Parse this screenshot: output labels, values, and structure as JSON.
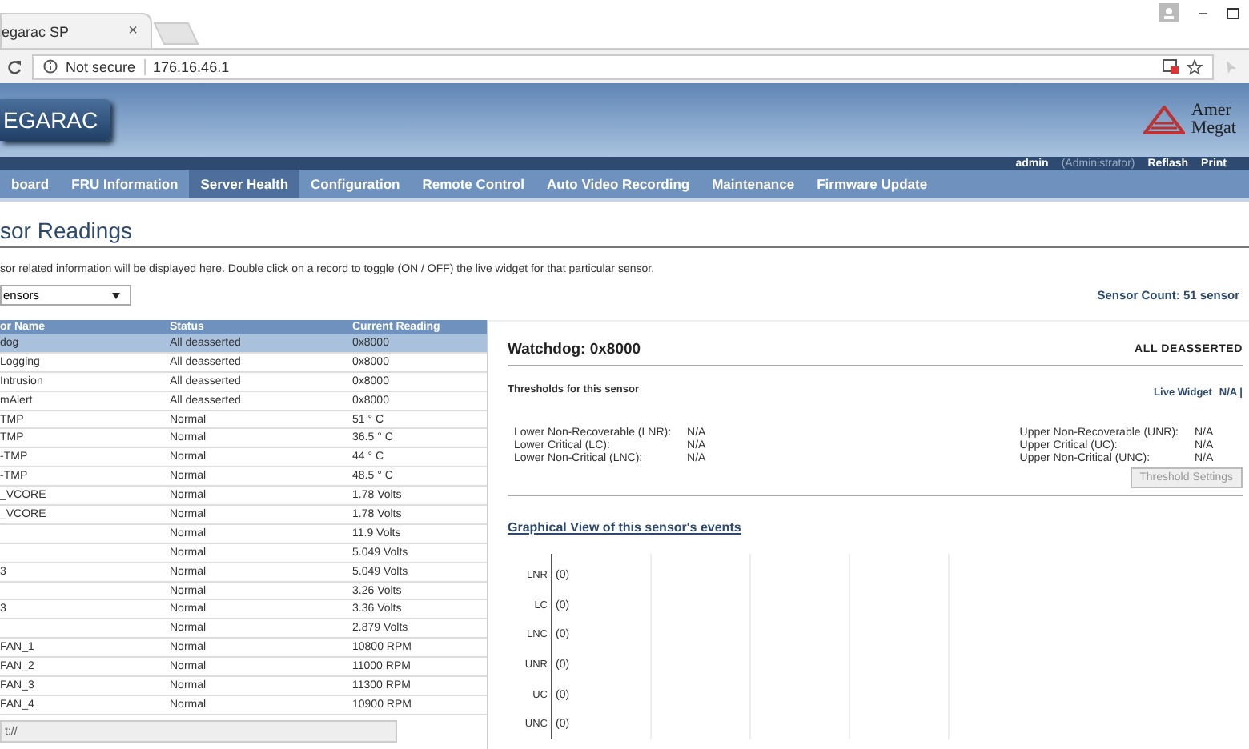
{
  "browser": {
    "tab_title": "egarac SP",
    "close": "×",
    "security": "Not secure",
    "url": "176.16.46.1",
    "window_controls": [
      "–"
    ]
  },
  "header": {
    "logo": "EGARAC",
    "brand_lines": [
      "Amer",
      "Megat"
    ],
    "user": "admin",
    "role": "(Administrator)",
    "links": [
      "Reflash",
      "Print"
    ]
  },
  "nav": [
    {
      "label": "board",
      "selected": false
    },
    {
      "label": "FRU Information",
      "selected": false
    },
    {
      "label": "Server Health",
      "selected": true
    },
    {
      "label": "Configuration",
      "selected": false
    },
    {
      "label": "Remote Control",
      "selected": false
    },
    {
      "label": "Auto Video Recording",
      "selected": false
    },
    {
      "label": "Maintenance",
      "selected": false
    },
    {
      "label": "Firmware Update",
      "selected": false
    }
  ],
  "page": {
    "title": "sor Readings",
    "description": "sor related information will be displayed here. Double click on a record to toggle (ON / OFF) the live widget for that particular sensor.",
    "filter": "ensors",
    "sensor_count": "Sensor Count: 51 sensor"
  },
  "table": {
    "columns": [
      "or Name",
      "Status",
      "Current Reading"
    ],
    "rows": [
      {
        "name": "dog",
        "status": "All deasserted",
        "reading": "0x8000",
        "selected": true
      },
      {
        "name": "Logging",
        "status": "All deasserted",
        "reading": "0x8000",
        "selected": false
      },
      {
        "name": "Intrusion",
        "status": "All deasserted",
        "reading": "0x8000",
        "selected": false
      },
      {
        "name": "mAlert",
        "status": "All deasserted",
        "reading": "0x8000",
        "selected": false
      },
      {
        "name": "TMP",
        "status": "Normal",
        "reading": "51 ° C",
        "selected": false
      },
      {
        "name": "TMP",
        "status": "Normal",
        "reading": "36.5 ° C",
        "selected": false
      },
      {
        "name": "-TMP",
        "status": "Normal",
        "reading": "44 ° C",
        "selected": false
      },
      {
        "name": "-TMP",
        "status": "Normal",
        "reading": "48.5 ° C",
        "selected": false
      },
      {
        "name": "_VCORE",
        "status": "Normal",
        "reading": "1.78 Volts",
        "selected": false
      },
      {
        "name": "_VCORE",
        "status": "Normal",
        "reading": "1.78 Volts",
        "selected": false
      },
      {
        "status": "Normal",
        "reading": "11.9 Volts",
        "selected": false
      },
      {
        "status": "Normal",
        "reading": "5.049 Volts",
        "selected": false
      },
      {
        "name": "3",
        "status": "Normal",
        "reading": "5.049 Volts",
        "selected": false
      },
      {
        "status": "Normal",
        "reading": "3.26 Volts",
        "selected": false
      },
      {
        "name": "3",
        "status": "Normal",
        "reading": "3.36 Volts",
        "selected": false
      },
      {
        "status": "Normal",
        "reading": "2.879 Volts",
        "selected": false
      },
      {
        "name": "FAN_1",
        "status": "Normal",
        "reading": "10800 RPM",
        "selected": false
      },
      {
        "name": "FAN_2",
        "status": "Normal",
        "reading": "11000 RPM",
        "selected": false
      },
      {
        "name": "FAN_3",
        "status": "Normal",
        "reading": "11300 RPM",
        "selected": false
      },
      {
        "name": "FAN_4",
        "status": "Normal",
        "reading": "10900 RPM",
        "selected": false
      }
    ]
  },
  "detail": {
    "title": "Watchdog: 0x8000",
    "state": "ALL DEASSERTED",
    "thresholds_heading": "Thresholds for this sensor",
    "live_widget": {
      "label": "Live Widget",
      "value": "N/A |"
    },
    "lower": [
      {
        "label": "Lower Non-Recoverable (LNR):",
        "value": "N/A"
      },
      {
        "label": "Lower Critical (LC):",
        "value": "N/A"
      },
      {
        "label": "Lower Non-Critical (LNC):",
        "value": "N/A"
      }
    ],
    "upper": [
      {
        "label": "Upper Non-Recoverable (UNR):",
        "value": "N/A"
      },
      {
        "label": "Upper Critical (UC):",
        "value": "N/A"
      },
      {
        "label": "Upper Non-Critical (UNC):",
        "value": "N/A"
      }
    ],
    "button": {
      "label": "Threshold Settings",
      "disabled": true
    },
    "graph_title": "Graphical View of this sensor's events",
    "events": [
      {
        "label": "LNR",
        "count": "(0)"
      },
      {
        "label": "LC",
        "count": "(0)"
      },
      {
        "label": "LNC",
        "count": "(0)"
      },
      {
        "label": "UNR",
        "count": "(0)"
      },
      {
        "label": "UC",
        "count": "(0)"
      },
      {
        "label": "UNC",
        "count": "(0)"
      }
    ]
  },
  "status_bar": "t://"
}
